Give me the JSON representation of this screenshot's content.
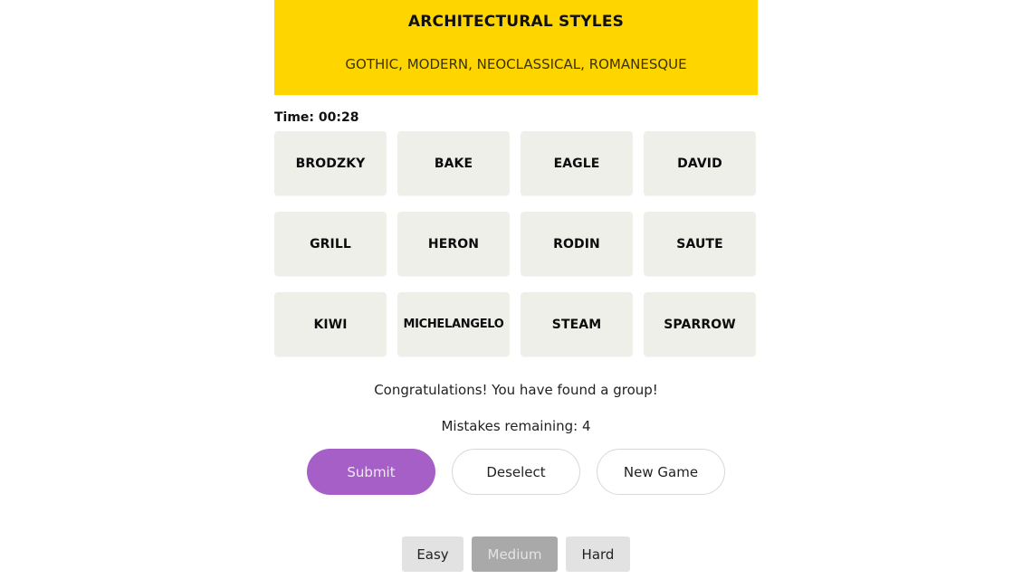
{
  "found_group": {
    "title": "ARCHITECTURAL STYLES",
    "members": "GOTHIC, MODERN, NEOCLASSICAL, ROMANESQUE",
    "color": "#FFD500"
  },
  "timer": {
    "label": "Time: 00:28"
  },
  "tiles": [
    "BRODZKY",
    "BAKE",
    "EAGLE",
    "DAVID",
    "GRILL",
    "HERON",
    "RODIN",
    "SAUTE",
    "KIWI",
    "MICHELANGELO",
    "STEAM",
    "SPARROW"
  ],
  "messages": {
    "status": "Congratulations! You have found a group!",
    "mistakes": "Mistakes remaining: 4"
  },
  "actions": {
    "submit": "Submit",
    "deselect": "Deselect",
    "new_game": "New Game",
    "submit_color": "#A55FC7"
  },
  "difficulty": {
    "options": [
      "Easy",
      "Medium",
      "Hard"
    ],
    "selected": "Medium"
  }
}
